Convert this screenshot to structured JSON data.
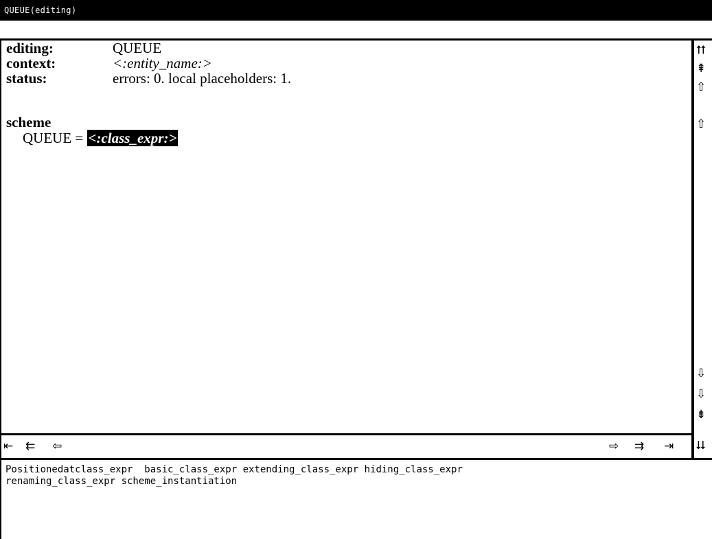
{
  "window": {
    "title": "QUEUE(editing)"
  },
  "editor": {
    "editing_label": "editing:",
    "editing_value": "QUEUE",
    "context_label": "context:",
    "context_value": "<:entity_name:>",
    "status_label": "status:",
    "status_value": "errors: 0.  local placeholders: 1.",
    "section_heading": "scheme",
    "scheme_name": "QUEUE",
    "scheme_equals": "=",
    "placeholder": "<:class_expr:>"
  },
  "vertical_scroll": {
    "up_buttons": [
      "⮅",
      "⇞",
      "⇧",
      "⇧"
    ],
    "down_buttons": [
      "⇩",
      "⇩",
      "⇟",
      "⮇"
    ]
  },
  "horizontal_scroll": {
    "left_buttons": [
      "⇤",
      "⇇",
      "⇦"
    ],
    "right_buttons": [
      "⇨",
      "⇉",
      "⇥"
    ]
  },
  "suggestions": {
    "line1": "Positionedatclass_expr  basic_class_expr extending_class_expr hiding_class_expr",
    "line2": "renaming_class_expr scheme_instantiation"
  }
}
